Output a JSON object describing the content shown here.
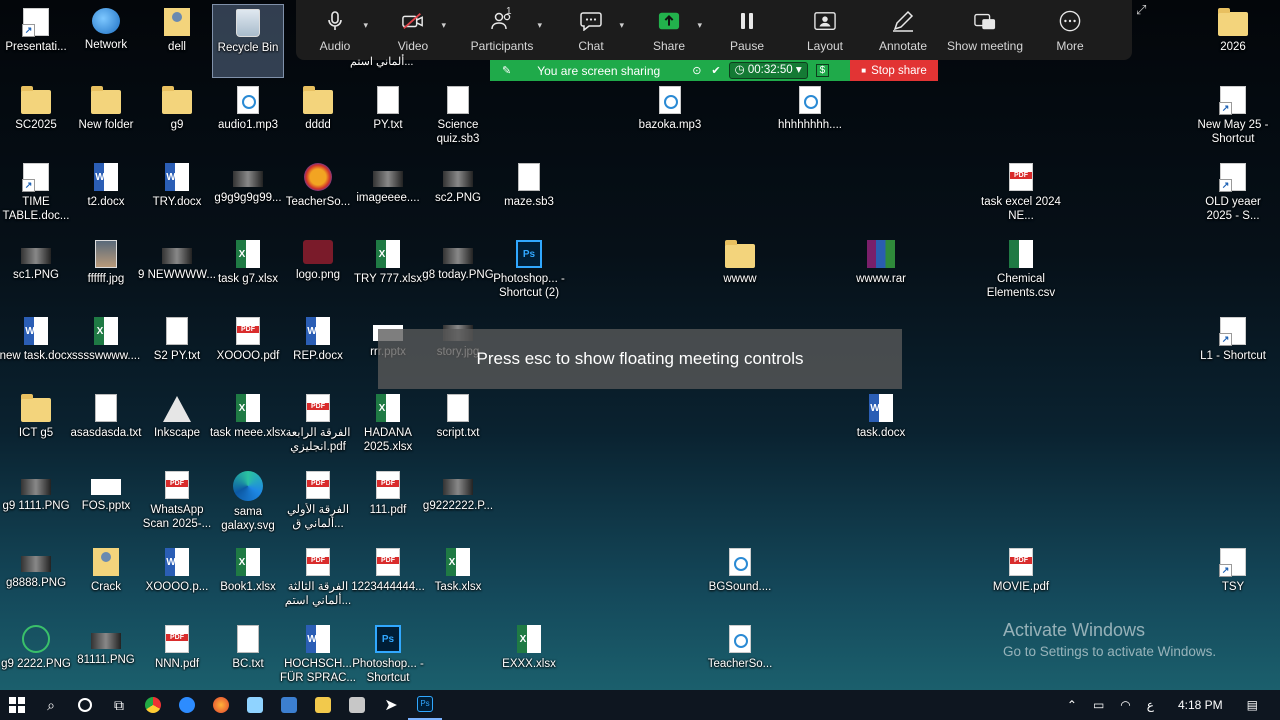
{
  "zoom": {
    "buttons": {
      "audio": "Audio",
      "video": "Video",
      "participants": "Participants",
      "participants_count": "1",
      "chat": "Chat",
      "share": "Share",
      "pause": "Pause",
      "layout": "Layout",
      "annotate": "Annotate",
      "show_meeting": "Show meeting",
      "more": "More"
    },
    "banner": {
      "sharing_text": "You are screen sharing",
      "timer": "00:32:50",
      "stop_share": "Stop share"
    },
    "toast": "Press esc to show floating meeting controls",
    "colors": {
      "toolbar_bg": "#1c1c1c",
      "banner_green": "#1faa4a",
      "stop_red": "#e23434"
    }
  },
  "desktop": {
    "icons": [
      {
        "label": "Presentati...",
        "icon": "shortcut"
      },
      {
        "label": "Network",
        "icon": "network"
      },
      {
        "label": "dell",
        "icon": "user-folder"
      },
      {
        "label": "Recycle Bin",
        "icon": "recycle-bin"
      },
      {
        "label": "2026",
        "icon": "folder"
      },
      {
        "label": "SC2025",
        "icon": "folder"
      },
      {
        "label": "New folder",
        "icon": "folder"
      },
      {
        "label": "g9",
        "icon": "folder"
      },
      {
        "label": "audio1.mp3",
        "icon": "audio"
      },
      {
        "label": "dddd",
        "icon": "folder"
      },
      {
        "label": "PY.txt",
        "icon": "text"
      },
      {
        "label": "Science quiz.sb3",
        "icon": "file"
      },
      {
        "label": "bazoka.mp3",
        "icon": "audio"
      },
      {
        "label": "hhhhhhhh....",
        "icon": "audio"
      },
      {
        "label": "New May 25 - Shortcut",
        "icon": "shortcut"
      },
      {
        "label": "TIME TABLE.doc...",
        "icon": "shortcut"
      },
      {
        "label": "t2.docx",
        "icon": "word"
      },
      {
        "label": "TRY.docx",
        "icon": "word"
      },
      {
        "label": "g9g9g9g99...",
        "icon": "image"
      },
      {
        "label": "TeacherSo...",
        "icon": "teacher"
      },
      {
        "label": "imageeee....",
        "icon": "image"
      },
      {
        "label": "sc2.PNG",
        "icon": "image"
      },
      {
        "label": "maze.sb3",
        "icon": "file"
      },
      {
        "label": "task excel 2024 NE...",
        "icon": "pdf"
      },
      {
        "label": "OLD yeaer 2025 - S...",
        "icon": "shortcut"
      },
      {
        "label": "sc1.PNG",
        "icon": "image"
      },
      {
        "label": "ffffff.jpg",
        "icon": "photo"
      },
      {
        "label": "9 NEWWWW...",
        "icon": "image"
      },
      {
        "label": "task g7.xlsx",
        "icon": "excel"
      },
      {
        "label": "logo.png",
        "icon": "logo"
      },
      {
        "label": "TRY 777.xlsx",
        "icon": "excel"
      },
      {
        "label": "g8 today.PNG",
        "icon": "image"
      },
      {
        "label": "Photoshop... - Shortcut (2)",
        "icon": "photoshop"
      },
      {
        "label": "wwww",
        "icon": "folder"
      },
      {
        "label": "wwww.rar",
        "icon": "rar"
      },
      {
        "label": "Chemical Elements.csv",
        "icon": "csv"
      },
      {
        "label": "new task.docx",
        "icon": "word"
      },
      {
        "label": "sssswwww....",
        "icon": "excel"
      },
      {
        "label": "S2 PY.txt",
        "icon": "text"
      },
      {
        "label": "XOOOO.pdf",
        "icon": "pdf"
      },
      {
        "label": "REP.docx",
        "icon": "word"
      },
      {
        "label": "rrr.pptx",
        "icon": "pptx"
      },
      {
        "label": "story.jpg",
        "icon": "image"
      },
      {
        "label": "L1 - Shortcut",
        "icon": "shortcut"
      },
      {
        "label": "ICT g5",
        "icon": "folder"
      },
      {
        "label": "asasdasda.txt",
        "icon": "text"
      },
      {
        "label": "Inkscape",
        "icon": "inkscape"
      },
      {
        "label": "task meee.xlsx",
        "icon": "excel"
      },
      {
        "label": "الفرقة الرابعة انجليزي.pdf",
        "icon": "pdf"
      },
      {
        "label": "HADANA 2025.xlsx",
        "icon": "excel"
      },
      {
        "label": "script.txt",
        "icon": "text"
      },
      {
        "label": "task.docx",
        "icon": "word"
      },
      {
        "label": "g9 1111.PNG",
        "icon": "image"
      },
      {
        "label": "FOS.pptx",
        "icon": "pptx"
      },
      {
        "label": "WhatsApp Scan 2025-...",
        "icon": "pdf"
      },
      {
        "label": "sama galaxy.svg",
        "icon": "edge"
      },
      {
        "label": "الفرقة الأولي ألماني ق...",
        "icon": "pdf"
      },
      {
        "label": "111.pdf",
        "icon": "pdf"
      },
      {
        "label": "g9222222.P...",
        "icon": "image"
      },
      {
        "label": "g8888.PNG",
        "icon": "image"
      },
      {
        "label": "Crack",
        "icon": "user-folder"
      },
      {
        "label": "XOOOO.p...",
        "icon": "word"
      },
      {
        "label": "Book1.xlsx",
        "icon": "excel"
      },
      {
        "label": "الفرقة الثالثة ألماني استم...",
        "icon": "pdf"
      },
      {
        "label": "1223444444...",
        "icon": "pdf"
      },
      {
        "label": "Task.xlsx",
        "icon": "excel"
      },
      {
        "label": "BGSound....",
        "icon": "audio"
      },
      {
        "label": "MOVIE.pdf",
        "icon": "pdf"
      },
      {
        "label": "TSY",
        "icon": "shortcut"
      },
      {
        "label": "g9 2222.PNG",
        "icon": "pen"
      },
      {
        "label": "81111.PNG",
        "icon": "image"
      },
      {
        "label": "NNN.pdf",
        "icon": "pdf"
      },
      {
        "label": "BC.txt",
        "icon": "text"
      },
      {
        "label": "HOCHSCH... FÜR SPRAC...",
        "icon": "word"
      },
      {
        "label": "Photoshop... - Shortcut",
        "icon": "photoshop"
      },
      {
        "label": "EXXX.xlsx",
        "icon": "excel"
      },
      {
        "label": "TeacherSo...",
        "icon": "audio"
      }
    ],
    "partial_label": "...ألماني استم"
  },
  "watermark": {
    "title": "Activate Windows",
    "subtitle": "Go to Settings to activate Windows."
  },
  "taskbar": {
    "items": [
      "start",
      "search",
      "cortana",
      "task-view",
      "chrome",
      "zoom",
      "firefox",
      "notepad",
      "screen",
      "explorer",
      "app",
      "cursor-app",
      "photoshop"
    ],
    "tray": {
      "lang": "ع",
      "time": "4:18 PM"
    }
  }
}
